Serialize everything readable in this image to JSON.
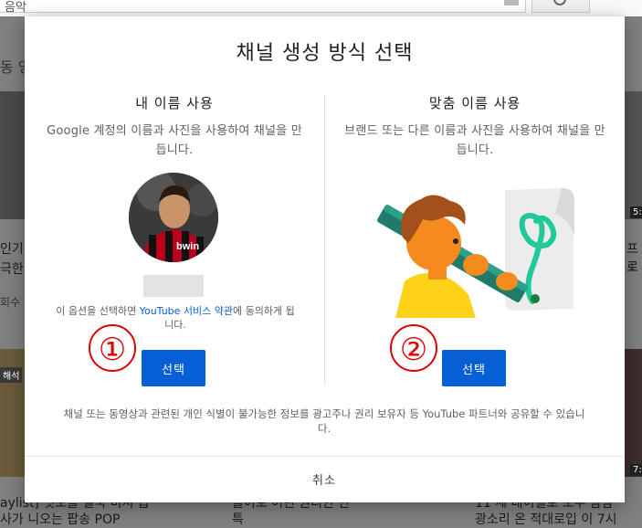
{
  "background": {
    "search_text": "음악",
    "chip_text": "동 영",
    "snippets_left": [
      "인기간순",
      "극한",
      "회수"
    ],
    "snippets_right": [
      "프로",
      "1"
    ],
    "bottom_left": "aylist] 멋모를 결국 비서 몹",
    "bottom_left_2": "사가 니오는 팝송 POP",
    "bottom_mid": "틀이로 어린 원리한 만",
    "bottom_mid_2": "특",
    "bottom_right": "11 세 대이밀로 모우 밤밤",
    "bottom_right_2": "광소리 온 적대로입 이 7시",
    "badge_1": "5:",
    "badge_2": "7:",
    "badge_3": "해석"
  },
  "modal": {
    "title": "채널 생성 방식 선택",
    "left": {
      "title": "내 이름 사용",
      "description": "Google 계정의 이름과 사진을 사용하여 채널을 만듭니다.",
      "terms_before": "이 옵션을 선택하면 ",
      "terms_link": "YouTube 서비스 약관",
      "terms_after": "에 동의하게 됩니다.",
      "button": "선택",
      "marker": "①"
    },
    "right": {
      "title": "맞춤 이름 사용",
      "description": "브랜드 또는 다른 이름과 사진을 사용하여 채널을 만듭니다.",
      "button": "선택",
      "marker": "②"
    },
    "disclaimer": "채널 또는 동영상과 관련된 개인 식별이 불가능한 정보를 광고주나 권리 보유자 등 YouTube 파트너와 공유할 수 있습니다.",
    "cancel": "취소"
  },
  "colors": {
    "accent": "#065fd4",
    "marker": "#e00000",
    "overlay": "#7f7f7f"
  }
}
